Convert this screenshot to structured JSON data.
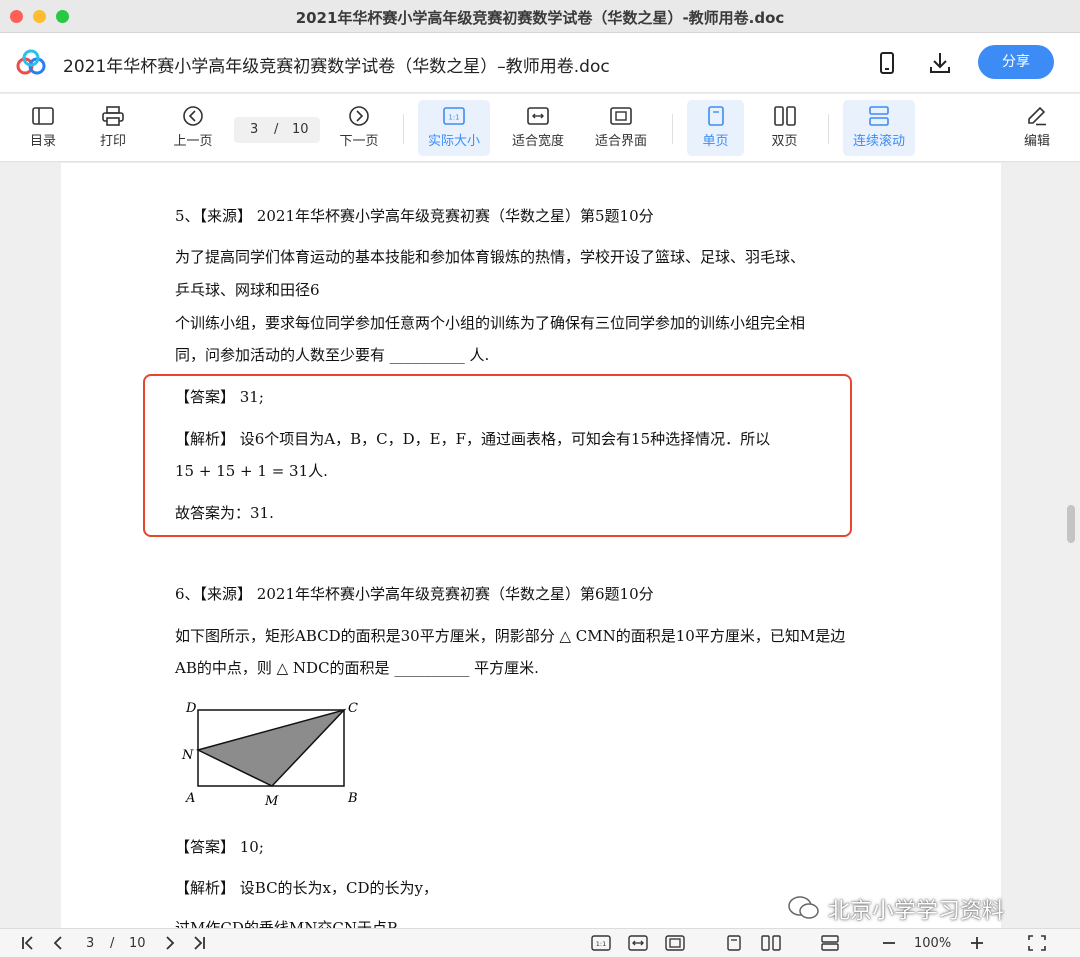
{
  "window": {
    "title": "2021年华杯赛小学高年级竞赛初赛数学试卷（华数之星）-教师用卷.doc"
  },
  "header": {
    "doc_title": "2021年华杯赛小学高年级竞赛初赛数学试卷（华数之星）–教师用卷.doc",
    "share_label": "分享"
  },
  "toolbar": {
    "toc": "目录",
    "print": "打印",
    "prev": "上一页",
    "page_current": "3",
    "page_sep": "/",
    "page_total": "10",
    "next": "下一页",
    "actual_size": "实际大小",
    "fit_width": "适合宽度",
    "fit_screen": "适合界面",
    "single_page": "单页",
    "double_page": "双页",
    "continuous": "连续滚动",
    "edit": "编辑",
    "actual_size_icon_text": "1:1"
  },
  "document": {
    "q5_title": "5、【来源】 2021年华杯赛小学高年级竞赛初赛（华数之星）第5题10分",
    "q5_line1": "为了提高同学们体育运动的基本技能和参加体育锻炼的热情，学校开设了篮球、足球、羽毛球、",
    "q5_line2": "乒乓球、网球和田径6",
    "q5_line3": "个训练小组，要求每位同学参加任意两个小组的训练为了确保有三位同学参加的训练小组完全相",
    "q5_line4": "同，问参加活动的人数至少要有 __________ 人.",
    "q5_answer": "【答案】 31;",
    "q5_analysis1": "【解析】 设6个项目为A，B，C，D，E，F，通过画表格，可知会有15种选择情况．所以",
    "q5_analysis2": "15 + 15 + 1 = 31人.",
    "q5_conclusion": "故答案为：31.",
    "q6_title": "6、【来源】 2021年华杯赛小学高年级竞赛初赛（华数之星）第6题10分",
    "q6_line1": "如下图所示，矩形ABCD的面积是30平方厘米，阴影部分 △ CMN的面积是10平方厘米，已知M是边",
    "q6_line2": "AB的中点，则 △ NDC的面积是 __________ 平方厘米.",
    "fig_labels": {
      "D": "D",
      "C": "C",
      "N": "N",
      "A": "A",
      "M": "M",
      "B": "B"
    },
    "q6_answer": "【答案】 10;",
    "q6_analysis1": "【解析】 设BC的长为x，CD的长为y，",
    "q6_analysis2": "过M作CD的垂线MN交CN于点P"
  },
  "watermark": "北京小学学习资料",
  "bottombar": {
    "page_current": "3",
    "page_sep": "/",
    "page_total": "10",
    "zoom": "100%",
    "actual_size_icon_text": "1:1"
  },
  "colors": {
    "accent": "#3d8cf5",
    "highlight_box": "#e8452c",
    "shaded_triangle": "#8c8c8c"
  }
}
